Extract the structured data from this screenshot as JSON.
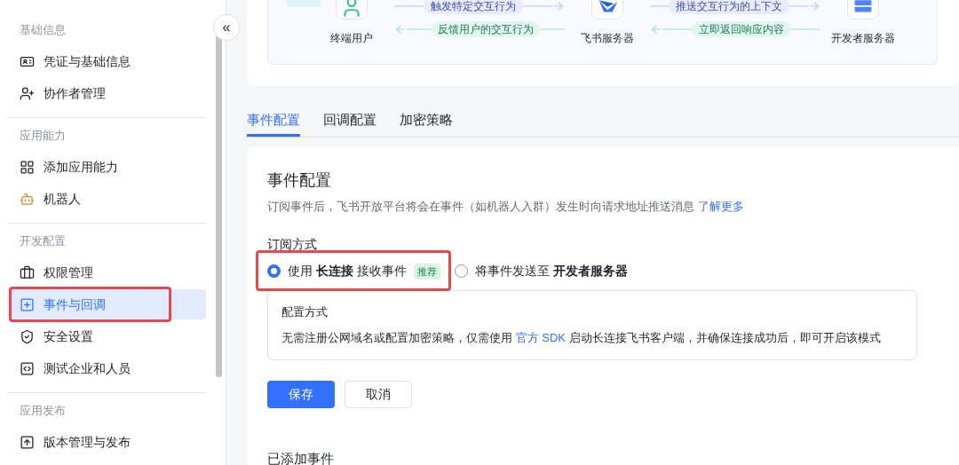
{
  "sidebar": {
    "collapse_icon": "«",
    "sections": [
      {
        "title": "基础信息",
        "items": [
          {
            "label": "凭证与基础信息",
            "selected": false,
            "highlighted": false
          },
          {
            "label": "协作者管理",
            "selected": false,
            "highlighted": false
          }
        ]
      },
      {
        "title": "应用能力",
        "items": [
          {
            "label": "添加应用能力",
            "selected": false,
            "highlighted": false
          },
          {
            "label": "机器人",
            "selected": false,
            "highlighted": false
          }
        ]
      },
      {
        "title": "开发配置",
        "items": [
          {
            "label": "权限管理",
            "selected": false,
            "highlighted": false
          },
          {
            "label": "事件与回调",
            "selected": true,
            "highlighted": true
          },
          {
            "label": "安全设置",
            "selected": false,
            "highlighted": false
          },
          {
            "label": "测试企业和人员",
            "selected": false,
            "highlighted": false
          }
        ]
      },
      {
        "title": "应用发布",
        "items": [
          {
            "label": "版本管理与发布",
            "selected": false,
            "highlighted": false
          }
        ]
      }
    ]
  },
  "diagram": {
    "nodes": [
      "终端用户",
      "飞书服务器",
      "开发者服务器"
    ],
    "arrows": [
      {
        "label": "触发特定交互行为",
        "kind": "forward"
      },
      {
        "label": "推送交互行为的上下文",
        "kind": "forward"
      },
      {
        "label": "反馈用户的交互行为",
        "kind": "back"
      },
      {
        "label": "立即返回响应内容",
        "kind": "back"
      }
    ]
  },
  "tabs": [
    {
      "label": "事件配置",
      "selected": true
    },
    {
      "label": "回调配置",
      "selected": false
    },
    {
      "label": "加密策略",
      "selected": false
    }
  ],
  "panel": {
    "title": "事件配置",
    "description": "订阅事件后，飞书开放平台将会在事件（如机器人入群）发生时向请求地址推送消息",
    "description_link": "了解更多",
    "subscription_label": "订阅方式",
    "options": [
      {
        "label": "使用 **长连接** 接收事件",
        "tag": "推荐",
        "selected": true,
        "highlighted": true
      },
      {
        "label": "将事件发送至 **开发者服务器**",
        "selected": false,
        "highlighted": false
      }
    ],
    "config_box": {
      "title": "配置方式",
      "text_before": "无需注册公网域名或配置加密策略，仅需使用",
      "link": "官方 SDK",
      "text_after": "启动长连接飞书客户端，并确保连接成功后，即可开启该模式"
    },
    "buttons": [
      {
        "label": "保存",
        "kind": "primary"
      },
      {
        "label": "取消",
        "kind": "secondary"
      }
    ],
    "added_events_title": "已添加事件"
  }
}
